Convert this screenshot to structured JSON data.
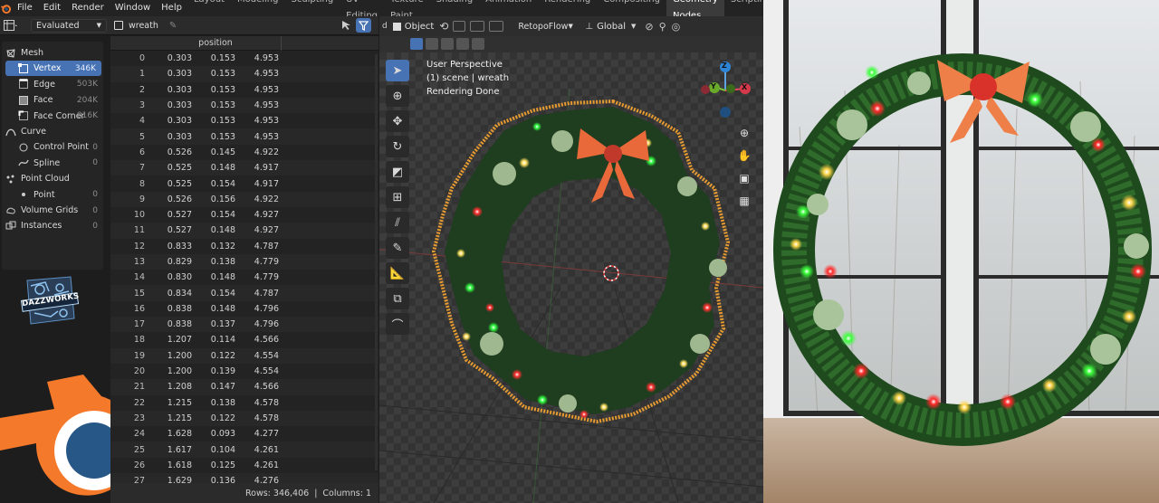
{
  "menu": [
    "File",
    "Edit",
    "Render",
    "Window",
    "Help"
  ],
  "workspaces": [
    "Layout",
    "Modeling",
    "Sculpting",
    "UV Editing",
    "Texture Paint",
    "Shading",
    "Animation",
    "Rendering",
    "Compositing",
    "Geometry Nodes",
    "Scripting"
  ],
  "active_workspace": "Geometry Nodes",
  "spreadsheet": {
    "evaluation_mode": "Evaluated",
    "object_name": "wreath",
    "column_header": "position",
    "footer_rows": "Rows: 346,406",
    "footer_sep": "|",
    "footer_columns": "Columns: 1"
  },
  "datasets": [
    {
      "label": "Mesh",
      "count": "",
      "level": 0,
      "icon": "mesh-icon"
    },
    {
      "label": "Vertex",
      "count": "346K",
      "level": 1,
      "icon": "vertex-icon",
      "active": true
    },
    {
      "label": "Edge",
      "count": "503K",
      "level": 1,
      "icon": "edge-icon"
    },
    {
      "label": "Face",
      "count": "204K",
      "level": 1,
      "icon": "face-icon"
    },
    {
      "label": "Face Corner",
      "count": "816K",
      "level": 1,
      "icon": "face-corner-icon"
    },
    {
      "label": "Curve",
      "count": "",
      "level": 0,
      "icon": "curve-icon"
    },
    {
      "label": "Control Point",
      "count": "0",
      "level": 1,
      "icon": "control-point-icon"
    },
    {
      "label": "Spline",
      "count": "0",
      "level": 1,
      "icon": "spline-icon"
    },
    {
      "label": "Point Cloud",
      "count": "",
      "level": 0,
      "icon": "point-cloud-icon"
    },
    {
      "label": "Point",
      "count": "0",
      "level": 1,
      "icon": "point-icon"
    },
    {
      "label": "Volume Grids",
      "count": "0",
      "level": 0,
      "icon": "volume-icon"
    },
    {
      "label": "Instances",
      "count": "0",
      "level": 0,
      "icon": "instances-icon"
    }
  ],
  "rows": [
    [
      "0",
      "0.303",
      "0.153",
      "4.953"
    ],
    [
      "1",
      "0.303",
      "0.153",
      "4.953"
    ],
    [
      "2",
      "0.303",
      "0.153",
      "4.953"
    ],
    [
      "3",
      "0.303",
      "0.153",
      "4.953"
    ],
    [
      "4",
      "0.303",
      "0.153",
      "4.953"
    ],
    [
      "5",
      "0.303",
      "0.153",
      "4.953"
    ],
    [
      "6",
      "0.526",
      "0.145",
      "4.922"
    ],
    [
      "7",
      "0.525",
      "0.148",
      "4.917"
    ],
    [
      "8",
      "0.525",
      "0.154",
      "4.917"
    ],
    [
      "9",
      "0.526",
      "0.156",
      "4.922"
    ],
    [
      "10",
      "0.527",
      "0.154",
      "4.927"
    ],
    [
      "11",
      "0.527",
      "0.148",
      "4.927"
    ],
    [
      "12",
      "0.833",
      "0.132",
      "4.787"
    ],
    [
      "13",
      "0.829",
      "0.138",
      "4.779"
    ],
    [
      "14",
      "0.830",
      "0.148",
      "4.779"
    ],
    [
      "15",
      "0.834",
      "0.154",
      "4.787"
    ],
    [
      "16",
      "0.838",
      "0.148",
      "4.796"
    ],
    [
      "17",
      "0.838",
      "0.137",
      "4.796"
    ],
    [
      "18",
      "1.207",
      "0.114",
      "4.566"
    ],
    [
      "19",
      "1.200",
      "0.122",
      "4.554"
    ],
    [
      "20",
      "1.200",
      "0.139",
      "4.554"
    ],
    [
      "21",
      "1.208",
      "0.147",
      "4.566"
    ],
    [
      "22",
      "1.215",
      "0.138",
      "4.578"
    ],
    [
      "23",
      "1.215",
      "0.122",
      "4.578"
    ],
    [
      "24",
      "1.628",
      "0.093",
      "4.277"
    ],
    [
      "25",
      "1.617",
      "0.104",
      "4.261"
    ],
    [
      "26",
      "1.618",
      "0.125",
      "4.261"
    ],
    [
      "27",
      "1.629",
      "0.136",
      "4.276"
    ],
    [
      "28",
      "1.640",
      "0.125",
      "4.292"
    ],
    [
      "29",
      "1.639",
      "0.103",
      "4.292"
    ]
  ],
  "logo_text": "DAZZWORKS",
  "viewport": {
    "mode": "Object",
    "addon": "RetopoFlow",
    "orientation": "Global",
    "view_name": "User Perspective",
    "scene_info": "(1) scene | wreath",
    "status": "Rendering Done",
    "axis_x": "X",
    "axis_y": "Y",
    "axis_z": "Z"
  },
  "colors": {
    "accent": "#4772b3",
    "blender_orange": "#f5792a",
    "blender_blue": "#265787",
    "selection_orange": "#f0a030"
  }
}
